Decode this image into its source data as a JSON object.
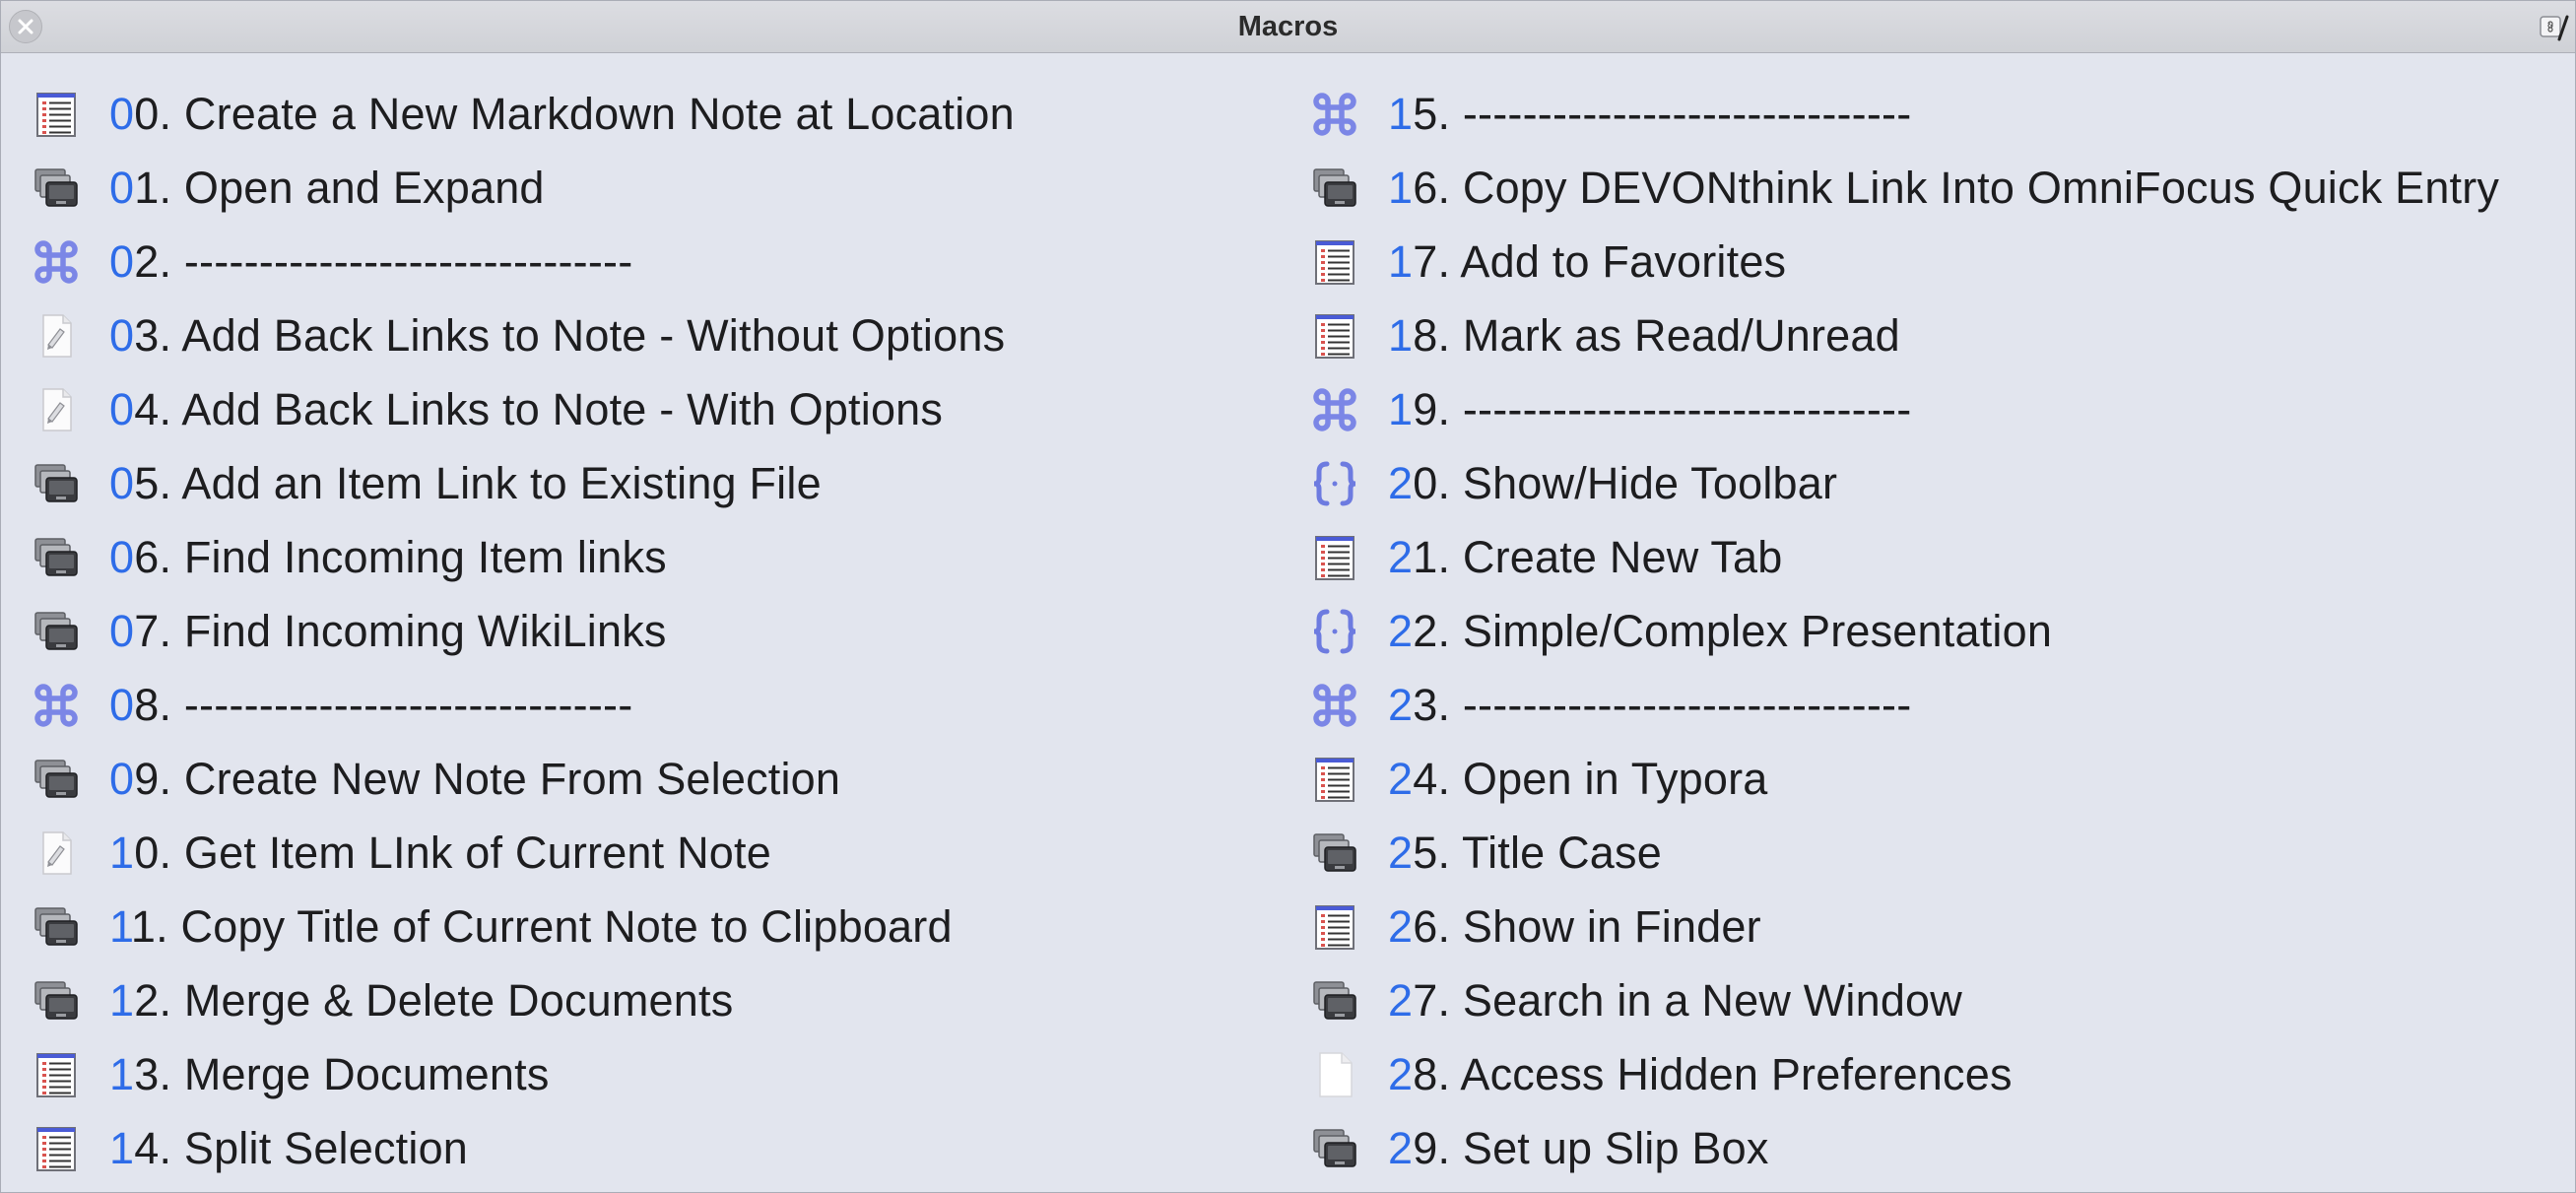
{
  "window": {
    "title": "Macros"
  },
  "columns": [
    {
      "items": [
        {
          "lead": "0",
          "rest": "0. Create a New Markdown Note at Location",
          "icon": "list-icon"
        },
        {
          "lead": "0",
          "rest": "1. Open and Expand",
          "icon": "applescript-icon"
        },
        {
          "lead": "0",
          "rest": "2. ------------------------------",
          "icon": "command-icon"
        },
        {
          "lead": "0",
          "rest": "3. Add Back Links to Note - Without Options",
          "icon": "script-doc-icon"
        },
        {
          "lead": "0",
          "rest": "4. Add Back Links to Note - With Options",
          "icon": "script-doc-icon"
        },
        {
          "lead": "0",
          "rest": "5. Add an Item Link to Existing File",
          "icon": "applescript-icon"
        },
        {
          "lead": "0",
          "rest": "6. Find Incoming Item links",
          "icon": "applescript-icon"
        },
        {
          "lead": "0",
          "rest": "7. Find Incoming WikiLinks",
          "icon": "applescript-icon"
        },
        {
          "lead": "0",
          "rest": "8. ------------------------------",
          "icon": "command-icon"
        },
        {
          "lead": "0",
          "rest": "9. Create New Note From Selection",
          "icon": "applescript-icon"
        },
        {
          "lead": "1",
          "rest": "0. Get Item LInk of Current Note",
          "icon": "script-doc-icon"
        },
        {
          "lead": "1",
          "rest": "1. Copy Title of Current Note to Clipboard",
          "icon": "applescript-icon"
        },
        {
          "lead": "1",
          "rest": "2. Merge & Delete Documents",
          "icon": "applescript-icon"
        },
        {
          "lead": "1",
          "rest": "3. Merge Documents",
          "icon": "list-icon"
        },
        {
          "lead": "1",
          "rest": "4. Split Selection",
          "icon": "list-icon"
        }
      ]
    },
    {
      "items": [
        {
          "lead": "1",
          "rest": "5. ------------------------------",
          "icon": "command-icon"
        },
        {
          "lead": "1",
          "rest": "6. Copy DEVONthink Link Into OmniFocus Quick Entry",
          "icon": "applescript-icon"
        },
        {
          "lead": "1",
          "rest": "7. Add to Favorites",
          "icon": "list-icon"
        },
        {
          "lead": "1",
          "rest": "8. Mark as Read/Unread",
          "icon": "list-icon"
        },
        {
          "lead": "1",
          "rest": "9. ------------------------------",
          "icon": "command-icon"
        },
        {
          "lead": "2",
          "rest": "0. Show/Hide Toolbar",
          "icon": "braces-icon"
        },
        {
          "lead": "2",
          "rest": "1. Create New Tab",
          "icon": "list-icon"
        },
        {
          "lead": "2",
          "rest": "2. Simple/Complex Presentation",
          "icon": "braces-icon"
        },
        {
          "lead": "2",
          "rest": "3. ------------------------------",
          "icon": "command-icon"
        },
        {
          "lead": "2",
          "rest": "4. Open in Typora",
          "icon": "list-icon"
        },
        {
          "lead": "2",
          "rest": "5. Title Case",
          "icon": "applescript-icon"
        },
        {
          "lead": "2",
          "rest": "6. Show in Finder",
          "icon": "list-icon"
        },
        {
          "lead": "2",
          "rest": "7. Search in a New Window",
          "icon": "applescript-icon"
        },
        {
          "lead": "2",
          "rest": "8. Access Hidden Preferences",
          "icon": "blank-doc-icon"
        },
        {
          "lead": "2",
          "rest": "9. Set up Slip Box",
          "icon": "applescript-icon"
        }
      ]
    }
  ],
  "colors": {
    "accent_number": "#2e6ce8",
    "command_icon": "#7b86e6",
    "list_red": "#d9534f"
  }
}
